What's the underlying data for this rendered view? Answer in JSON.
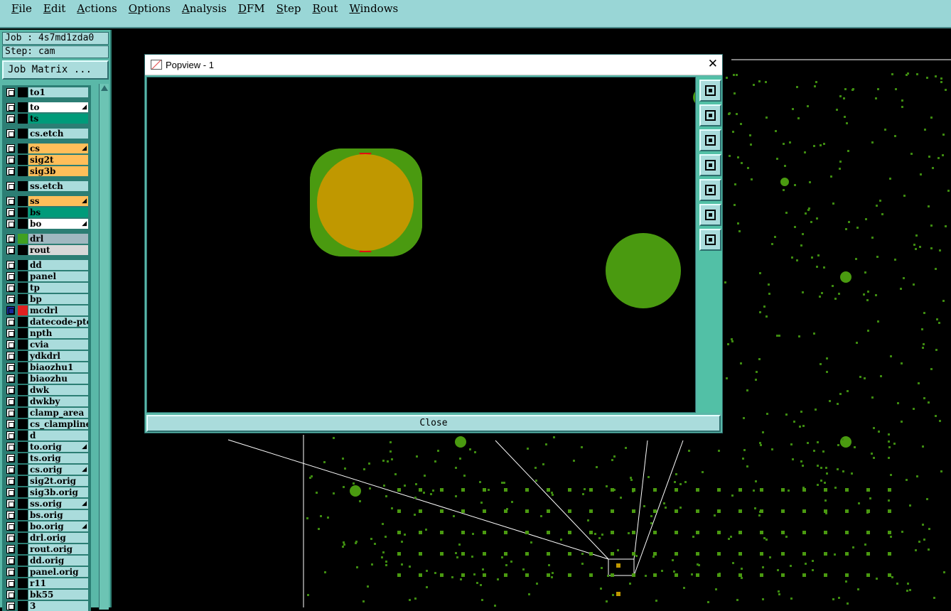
{
  "menubar": {
    "items": [
      "File",
      "Edit",
      "Actions",
      "Options",
      "Analysis",
      "DFM",
      "Step",
      "Rout",
      "Windows"
    ]
  },
  "left_panel": {
    "job": "Job : 4s7md1zda0",
    "step": "Step: cam",
    "job_matrix_button": "Job Matrix ...",
    "layers": [
      {
        "name": "to1",
        "color": "#aadcdc"
      },
      {
        "name": "to",
        "color": "#ffffff",
        "flag": true
      },
      {
        "name": "ts",
        "color": "#009b7a"
      },
      {
        "name": "cs.etch",
        "color": "#aadcdc"
      },
      {
        "name": "cs",
        "color": "#ffbe5a",
        "flag": true
      },
      {
        "name": "sig2t",
        "color": "#ffbe5a"
      },
      {
        "name": "sig3b",
        "color": "#ffbe5a"
      },
      {
        "name": "ss.etch",
        "color": "#aadcdc"
      },
      {
        "name": "ss",
        "color": "#ffbe5a",
        "flag": true
      },
      {
        "name": "bs",
        "color": "#009b7a"
      },
      {
        "name": "bo",
        "color": "#ffffff",
        "flag": true
      },
      {
        "name": "drl",
        "color": "#a0b8c0",
        "swatch": "#40a020"
      },
      {
        "name": "rout",
        "color": "#d8d8d8"
      },
      {
        "name": "dd",
        "color": "#aadcdc"
      },
      {
        "name": "panel",
        "color": "#aadcdc"
      },
      {
        "name": "tp",
        "color": "#aadcdc"
      },
      {
        "name": "bp",
        "color": "#aadcdc"
      },
      {
        "name": "mcdrl",
        "color": "#aadcdc",
        "swatch": "#e02020",
        "checked": true
      },
      {
        "name": "datecode-ptc",
        "color": "#aadcdc"
      },
      {
        "name": "npth",
        "color": "#aadcdc"
      },
      {
        "name": "cvia",
        "color": "#aadcdc"
      },
      {
        "name": "ydkdrl",
        "color": "#aadcdc"
      },
      {
        "name": "biaozhu1",
        "color": "#aadcdc"
      },
      {
        "name": "biaozhu",
        "color": "#aadcdc"
      },
      {
        "name": "dwk",
        "color": "#aadcdc"
      },
      {
        "name": "dwkby",
        "color": "#aadcdc"
      },
      {
        "name": "clamp_area",
        "color": "#aadcdc"
      },
      {
        "name": "cs_clampline",
        "color": "#aadcdc"
      },
      {
        "name": "d",
        "color": "#aadcdc"
      },
      {
        "name": "to.orig",
        "color": "#aadcdc",
        "flag": true
      },
      {
        "name": "ts.orig",
        "color": "#aadcdc"
      },
      {
        "name": "cs.orig",
        "color": "#aadcdc",
        "flag": true
      },
      {
        "name": "sig2t.orig",
        "color": "#aadcdc"
      },
      {
        "name": "sig3b.orig",
        "color": "#aadcdc"
      },
      {
        "name": "ss.orig",
        "color": "#aadcdc",
        "flag": true
      },
      {
        "name": "bs.orig",
        "color": "#aadcdc"
      },
      {
        "name": "bo.orig",
        "color": "#aadcdc",
        "flag": true
      },
      {
        "name": "drl.orig",
        "color": "#aadcdc"
      },
      {
        "name": "rout.orig",
        "color": "#aadcdc"
      },
      {
        "name": "dd.orig",
        "color": "#aadcdc"
      },
      {
        "name": "panel.orig",
        "color": "#aadcdc"
      },
      {
        "name": "r11",
        "color": "#aadcdc"
      },
      {
        "name": "bk55",
        "color": "#aadcdc"
      },
      {
        "name": "3",
        "color": "#aadcdc"
      }
    ]
  },
  "popview": {
    "title": "Popview - 1",
    "close_button": "Close",
    "tools": [
      "zoom-window-icon",
      "pan-up-icon",
      "pan-down-icon",
      "pan-left-icon",
      "pan-right-icon",
      "zoom-fit-icon",
      "zoom-home-icon"
    ]
  },
  "colors": {
    "pad_green": "#4a9a10",
    "pad_orange": "#c09800",
    "highlight_red": "#e01010"
  }
}
